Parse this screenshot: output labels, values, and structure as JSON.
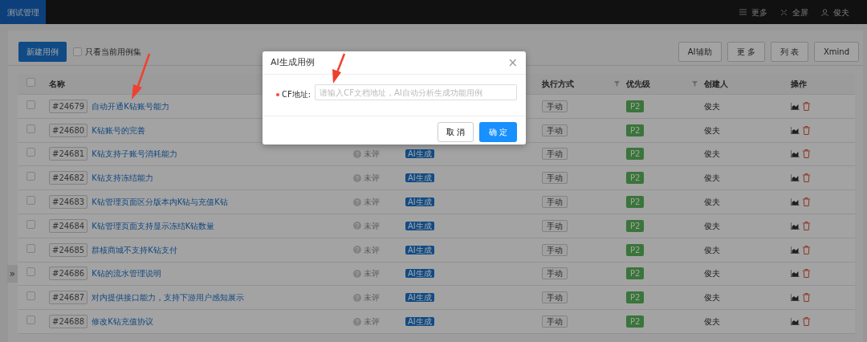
{
  "navbar": {
    "tab": "测试管理",
    "items": [
      {
        "kind": "menu",
        "label": "更多"
      },
      {
        "kind": "fullscreen",
        "label": "全屏"
      },
      {
        "kind": "user",
        "label": "俊夫"
      }
    ]
  },
  "toolbar": {
    "new_button": "新建用例",
    "filter_checkbox": {
      "label": "只看当前用例集",
      "checked": false
    },
    "buttons": [
      "AI辅助",
      "更 多",
      "列 表",
      "Xmind"
    ]
  },
  "table": {
    "header_checkbox": {
      "checked": false
    },
    "columns": [
      {
        "label": "名称",
        "filter": false
      },
      {
        "label": "执行方式",
        "filter": true
      },
      {
        "label": "优先级",
        "filter": true
      },
      {
        "label": "创建人",
        "filter": false
      },
      {
        "label": "操作",
        "filter": false
      }
    ],
    "rows": [
      {
        "checked": false,
        "id": "#24679",
        "name": "自动开通K钻账号能力",
        "mode": "手动",
        "priority": "P2",
        "creator": "俊夫"
      },
      {
        "checked": false,
        "id": "#24680",
        "name": "K钻账号的完善",
        "mode": "手动",
        "priority": "P2",
        "creator": "俊夫"
      },
      {
        "checked": false,
        "id": "#24681",
        "name": "K钻支持子账号消耗能力",
        "review": "未评",
        "tag": "AI生成",
        "mode": "手动",
        "priority": "P2",
        "creator": "俊夫"
      },
      {
        "checked": false,
        "id": "#24682",
        "name": "K钻支持冻结能力",
        "review": "未评",
        "tag": "AI生成",
        "mode": "手动",
        "priority": "P2",
        "creator": "俊夫"
      },
      {
        "checked": false,
        "id": "#24683",
        "name": "K钻管理页面区分版本内K钻与充值K钻",
        "review": "未评",
        "tag": "AI生成",
        "mode": "手动",
        "priority": "P2",
        "creator": "俊夫"
      },
      {
        "checked": false,
        "id": "#24684",
        "name": "K钻管理页面支持显示冻结K钻数量",
        "review": "未评",
        "tag": "AI生成",
        "mode": "手动",
        "priority": "P2",
        "creator": "俊夫"
      },
      {
        "checked": false,
        "id": "#24685",
        "name": "群核商城不支持K钻支付",
        "review": "未评",
        "tag": "AI生成",
        "mode": "手动",
        "priority": "P2",
        "creator": "俊夫"
      },
      {
        "checked": false,
        "id": "#24686",
        "name": "K钻的流水管理说明",
        "review": "未评",
        "tag": "AI生成",
        "mode": "手动",
        "priority": "P2",
        "creator": "俊夫"
      },
      {
        "checked": false,
        "id": "#24687",
        "name": "对内提供接口能力，支持下游用户感知展示",
        "review": "未评",
        "tag": "AI生成",
        "mode": "手动",
        "priority": "P2",
        "creator": "俊夫"
      },
      {
        "checked": false,
        "id": "#24688",
        "name": "修改K钻充值协议",
        "review": "未评",
        "tag": "AI生成",
        "mode": "手动",
        "priority": "P2",
        "creator": "俊夫"
      }
    ]
  },
  "side_toggle": "»",
  "modal": {
    "title": "AI生成用例",
    "close": "×",
    "field": {
      "required": true,
      "label": "CF地址:",
      "placeholder": "请输入CF文档地址，AI自动分析生成功能用例"
    },
    "buttons": [
      "取 消",
      "确 定"
    ]
  }
}
